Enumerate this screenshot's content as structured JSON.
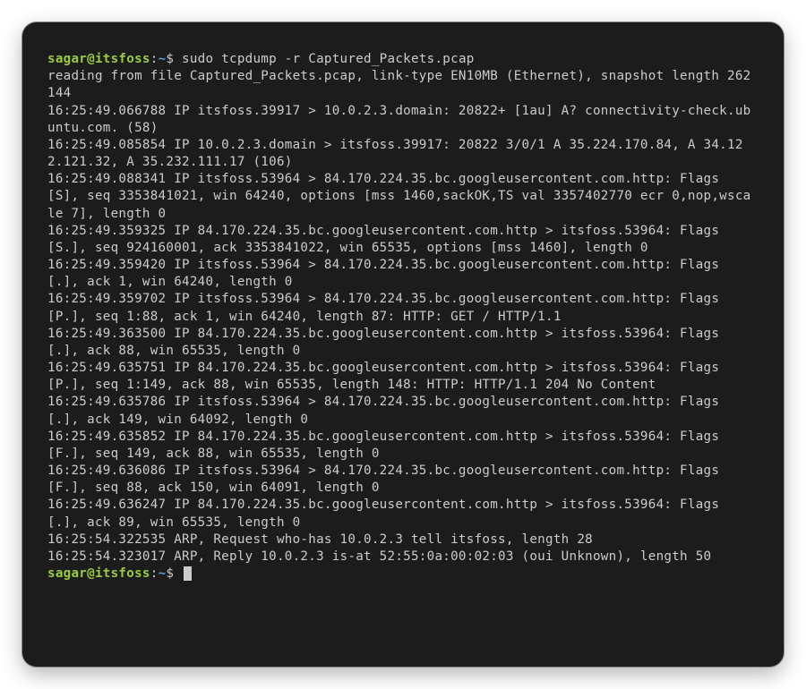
{
  "prompt": {
    "user_host": "sagar@itsfoss",
    "separator": ":",
    "path": "~",
    "symbol": "$"
  },
  "command": "sudo tcpdump -r Captured_Packets.pcap",
  "output_lines": [
    "reading from file Captured_Packets.pcap, link-type EN10MB (Ethernet), snapshot length 262144",
    "16:25:49.066788 IP itsfoss.39917 > 10.0.2.3.domain: 20822+ [1au] A? connectivity-check.ubuntu.com. (58)",
    "16:25:49.085854 IP 10.0.2.3.domain > itsfoss.39917: 20822 3/0/1 A 35.224.170.84, A 34.122.121.32, A 35.232.111.17 (106)",
    "16:25:49.088341 IP itsfoss.53964 > 84.170.224.35.bc.googleusercontent.com.http: Flags [S], seq 3353841021, win 64240, options [mss 1460,sackOK,TS val 3357402770 ecr 0,nop,wscale 7], length 0",
    "16:25:49.359325 IP 84.170.224.35.bc.googleusercontent.com.http > itsfoss.53964: Flags [S.], seq 924160001, ack 3353841022, win 65535, options [mss 1460], length 0",
    "16:25:49.359420 IP itsfoss.53964 > 84.170.224.35.bc.googleusercontent.com.http: Flags [.], ack 1, win 64240, length 0",
    "16:25:49.359702 IP itsfoss.53964 > 84.170.224.35.bc.googleusercontent.com.http: Flags [P.], seq 1:88, ack 1, win 64240, length 87: HTTP: GET / HTTP/1.1",
    "16:25:49.363500 IP 84.170.224.35.bc.googleusercontent.com.http > itsfoss.53964: Flags [.], ack 88, win 65535, length 0",
    "16:25:49.635751 IP 84.170.224.35.bc.googleusercontent.com.http > itsfoss.53964: Flags [P.], seq 1:149, ack 88, win 65535, length 148: HTTP: HTTP/1.1 204 No Content",
    "16:25:49.635786 IP itsfoss.53964 > 84.170.224.35.bc.googleusercontent.com.http: Flags [.], ack 149, win 64092, length 0",
    "16:25:49.635852 IP 84.170.224.35.bc.googleusercontent.com.http > itsfoss.53964: Flags [F.], seq 149, ack 88, win 65535, length 0",
    "16:25:49.636086 IP itsfoss.53964 > 84.170.224.35.bc.googleusercontent.com.http: Flags [F.], seq 88, ack 150, win 64091, length 0",
    "16:25:49.636247 IP 84.170.224.35.bc.googleusercontent.com.http > itsfoss.53964: Flags [.], ack 89, win 65535, length 0",
    "16:25:54.322535 ARP, Request who-has 10.0.2.3 tell itsfoss, length 28",
    "16:25:54.323017 ARP, Reply 10.0.2.3 is-at 52:55:0a:00:02:03 (oui Unknown), length 50"
  ]
}
